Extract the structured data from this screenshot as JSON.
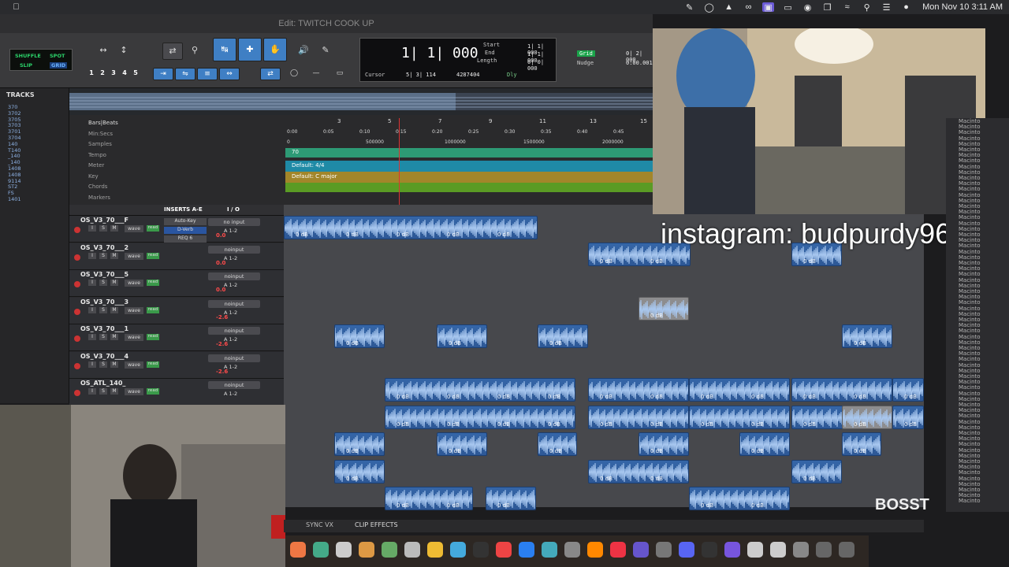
{
  "menubar": {
    "clock": "Mon Nov 10  3:11 AM"
  },
  "window": {
    "title": "Edit: TWITCH COOK UP"
  },
  "edit_modes": {
    "shuffle": "SHUFFLE",
    "spot": "SPOT",
    "slip": "SLIP",
    "grid": "GRID"
  },
  "zoom_presets": [
    "1",
    "2",
    "3",
    "4",
    "5"
  ],
  "counter": {
    "main": "1| 1| 000",
    "start_label": "Start",
    "start_value": "1| 1| 000",
    "end_label": "End",
    "end_value": "1| 1| 000",
    "length_label": "Length",
    "length_value": "0| 0| 000",
    "cursor_label": "Cursor",
    "cursor_value": "5| 3| 114",
    "sample_value": "4287404",
    "dly_label": "Dly"
  },
  "grid": {
    "grid_label": "Grid",
    "grid_value": "0| 2| 000",
    "nudge_label": "Nudge",
    "nudge_value": "0:00.001"
  },
  "tracklist": {
    "header": "TRACKS",
    "items": [
      "370",
      "3702",
      "3705",
      "3703",
      "3701",
      "3704",
      "140",
      "T140",
      "_140",
      "_140",
      "1408",
      "1408",
      "9114",
      "ST2",
      "FS",
      "1401"
    ]
  },
  "rulers": {
    "labels": [
      "Bars|Beats",
      "Min:Secs",
      "Samples",
      "Tempo",
      "Meter",
      "Key",
      "Chords",
      "Markers"
    ],
    "bars": [
      "3",
      "5",
      "7",
      "9",
      "11",
      "13",
      "15"
    ],
    "mins": [
      "0:00",
      "0:05",
      "0:10",
      "0:15",
      "0:20",
      "0:25",
      "0:30",
      "0:35",
      "0:40",
      "0:45"
    ],
    "samples": [
      "0",
      "500000",
      "1000000",
      "1500000",
      "2000000"
    ],
    "tempo_value": "70",
    "meter_value": "Default: 4/4",
    "key_value": "Default: C major"
  },
  "track_header": {
    "inserts": "INSERTS A-E",
    "io": "I / O"
  },
  "tracks": [
    {
      "name": "OS_V3_70___F",
      "io": "no input",
      "insert1": "Auto-Key",
      "insert2": "D-Verb",
      "insert3": "REQ 6",
      "out": "A 1-2",
      "vol": "0.0"
    },
    {
      "name": "OS_V3_70___2",
      "io": "noinput",
      "out": "A 1-2",
      "vol": "0.0"
    },
    {
      "name": "OS_V3_70___5",
      "io": "noinput",
      "out": "A 1-2",
      "vol": "0.0"
    },
    {
      "name": "OS_V3_70___3",
      "io": "noinput",
      "out": "A 1-2",
      "vol": "-2.6"
    },
    {
      "name": "OS_V3_70___1",
      "io": "noinput",
      "out": "A 1-2",
      "vol": "-2.6"
    },
    {
      "name": "OS_V3_70___4",
      "io": "noinput",
      "out": "A 1-2",
      "vol": "-2.6"
    },
    {
      "name": "OS_ATL_140_",
      "io": "noinput",
      "out": "A 1-2",
      "vol": ""
    }
  ],
  "track_buttons": {
    "s": "S",
    "m": "M",
    "i": "I",
    "wave": "wave",
    "read": "read"
  },
  "clip_gain": "0 dB",
  "overlay": {
    "instagram": "instagram: budpurdy96",
    "logo": "BOSST"
  },
  "bins": {
    "label": "Macinto"
  },
  "bottom": {
    "sync": "SYNC VX",
    "clip_effects": "CLIP EFFECTS"
  }
}
